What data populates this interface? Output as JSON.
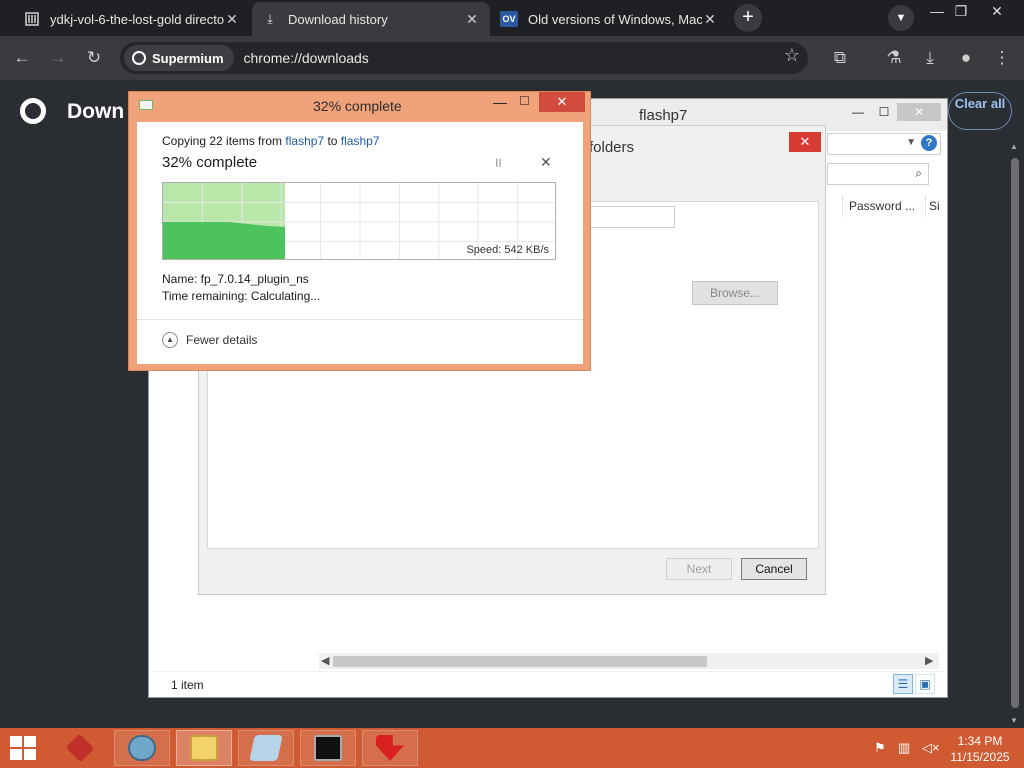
{
  "browser": {
    "tabs": [
      {
        "title": "ydkj-vol-6-the-lost-gold directo",
        "icon": "archive-icon",
        "active": false
      },
      {
        "title": "Download history",
        "icon": "download-icon",
        "active": true
      },
      {
        "title": "Old versions of Windows, Mac a",
        "icon": "ov-icon",
        "favicon_text": "OV",
        "active": false
      }
    ],
    "omnibox": {
      "chip": "Supermium",
      "url": "chrome://downloads"
    }
  },
  "downloads_page": {
    "heading": "Down",
    "clear_all": "Clear all"
  },
  "explorer": {
    "title": "flashp7",
    "columns": [
      "Password ...",
      "Si"
    ],
    "status": "1 item"
  },
  "wizard": {
    "heading_fragment": "folders",
    "browse_label": "Browse...",
    "next_label": "Next",
    "cancel_label": "Cancel"
  },
  "copy_dialog": {
    "title": "32% complete",
    "copying_prefix": "Copying 22 items from",
    "source": "flashp7",
    "to_word": "to",
    "destination": "flashp7",
    "percent_text": "32% complete",
    "progress": 0.32,
    "speed": "Speed: 542 KB/s",
    "name": "Name:  fp_7.0.14_plugin_ns",
    "time_remaining": "Time remaining:  Calculating...",
    "fewer_details": "Fewer details",
    "accent_color": "#4cc35c"
  },
  "taskbar": {
    "apps": [
      "red-cube-app-icon",
      "globe-app-icon",
      "file-explorer-icon",
      "notepad-icon",
      "cmd-icon",
      "red-arrow-app-icon"
    ],
    "clock_time": "1:34 PM",
    "clock_date": "11/15/2025"
  }
}
